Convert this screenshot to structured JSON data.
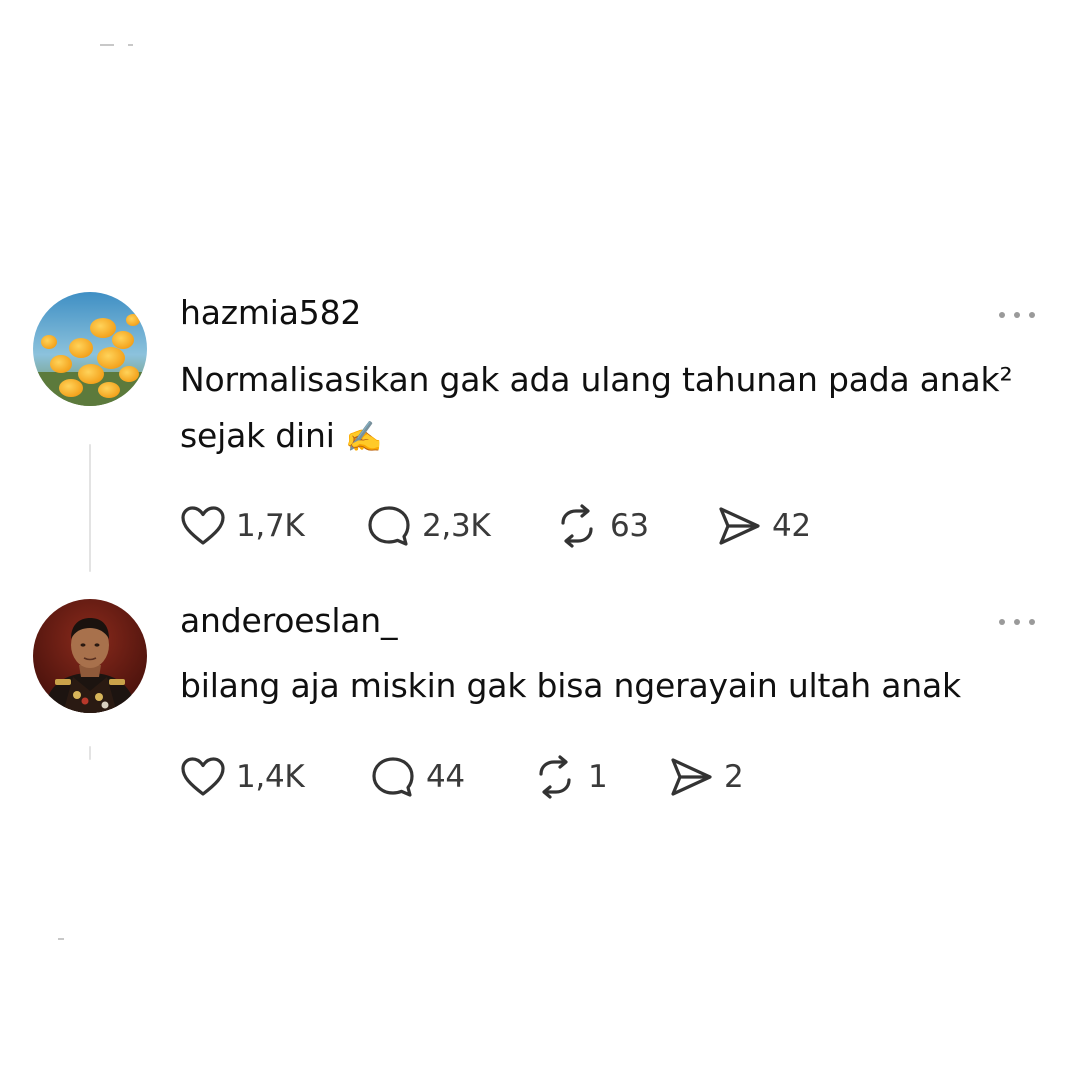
{
  "posts": [
    {
      "username": "hazmia582",
      "text": "Normalisasikan gak ada ulang tahunan pada anak² sejak dini",
      "emoji": "✍️",
      "avatar": "flower-field-avatar",
      "likes": "1,7K",
      "replies": "2,3K",
      "reposts": "63",
      "shares": "42"
    },
    {
      "username": "anderoeslan_",
      "text": "bilang aja miskin gak bisa ngerayain ultah anak",
      "avatar": "military-portrait-avatar",
      "likes": "1,4K",
      "replies": "44",
      "reposts": "1",
      "shares": "2"
    }
  ],
  "icons": {
    "like": "heart-icon",
    "reply": "comment-icon",
    "repost": "repost-icon",
    "share": "share-icon",
    "more": "more-icon"
  },
  "colors": {
    "text": "#101010",
    "muted": "#9a9a9a",
    "thread_line": "#e3e3e3"
  }
}
